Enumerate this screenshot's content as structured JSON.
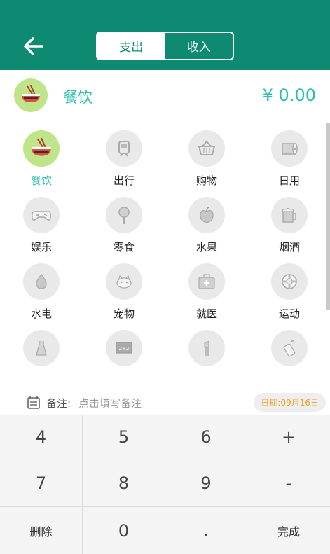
{
  "header": {
    "tabs": [
      {
        "label": "支出",
        "active": true
      },
      {
        "label": "收入",
        "active": false
      }
    ],
    "accent_color": "#0f8a72"
  },
  "selected": {
    "name": "餐饮",
    "amount": "¥ 0.00",
    "icon": "rice-bowl-icon"
  },
  "categories": [
    {
      "label": "餐饮",
      "icon": "rice-bowl-icon",
      "selected": true
    },
    {
      "label": "出行",
      "icon": "train-icon"
    },
    {
      "label": "购物",
      "icon": "basket-icon"
    },
    {
      "label": "日用",
      "icon": "tissue-roll-icon"
    },
    {
      "label": "娱乐",
      "icon": "gamepad-icon"
    },
    {
      "label": "零食",
      "icon": "lollipop-icon"
    },
    {
      "label": "水果",
      "icon": "apple-icon"
    },
    {
      "label": "烟酒",
      "icon": "beer-mug-icon"
    },
    {
      "label": "水电",
      "icon": "water-drop-icon"
    },
    {
      "label": "宠物",
      "icon": "pet-icon"
    },
    {
      "label": "就医",
      "icon": "medical-kit-icon"
    },
    {
      "label": "运动",
      "icon": "lifebuoy-icon"
    },
    {
      "label": "",
      "icon": "dress-icon"
    },
    {
      "label": "",
      "icon": "blackboard-icon"
    },
    {
      "label": "",
      "icon": "lipstick-icon"
    },
    {
      "label": "",
      "icon": "baby-bottle-icon"
    }
  ],
  "note": {
    "label": "备注:",
    "placeholder": "点击填写备注",
    "date": "日期:09月16日"
  },
  "keypad": {
    "keys": [
      "4",
      "5",
      "6",
      "+",
      "7",
      "8",
      "9",
      "-",
      "删除",
      "0",
      ".",
      "完成"
    ]
  }
}
